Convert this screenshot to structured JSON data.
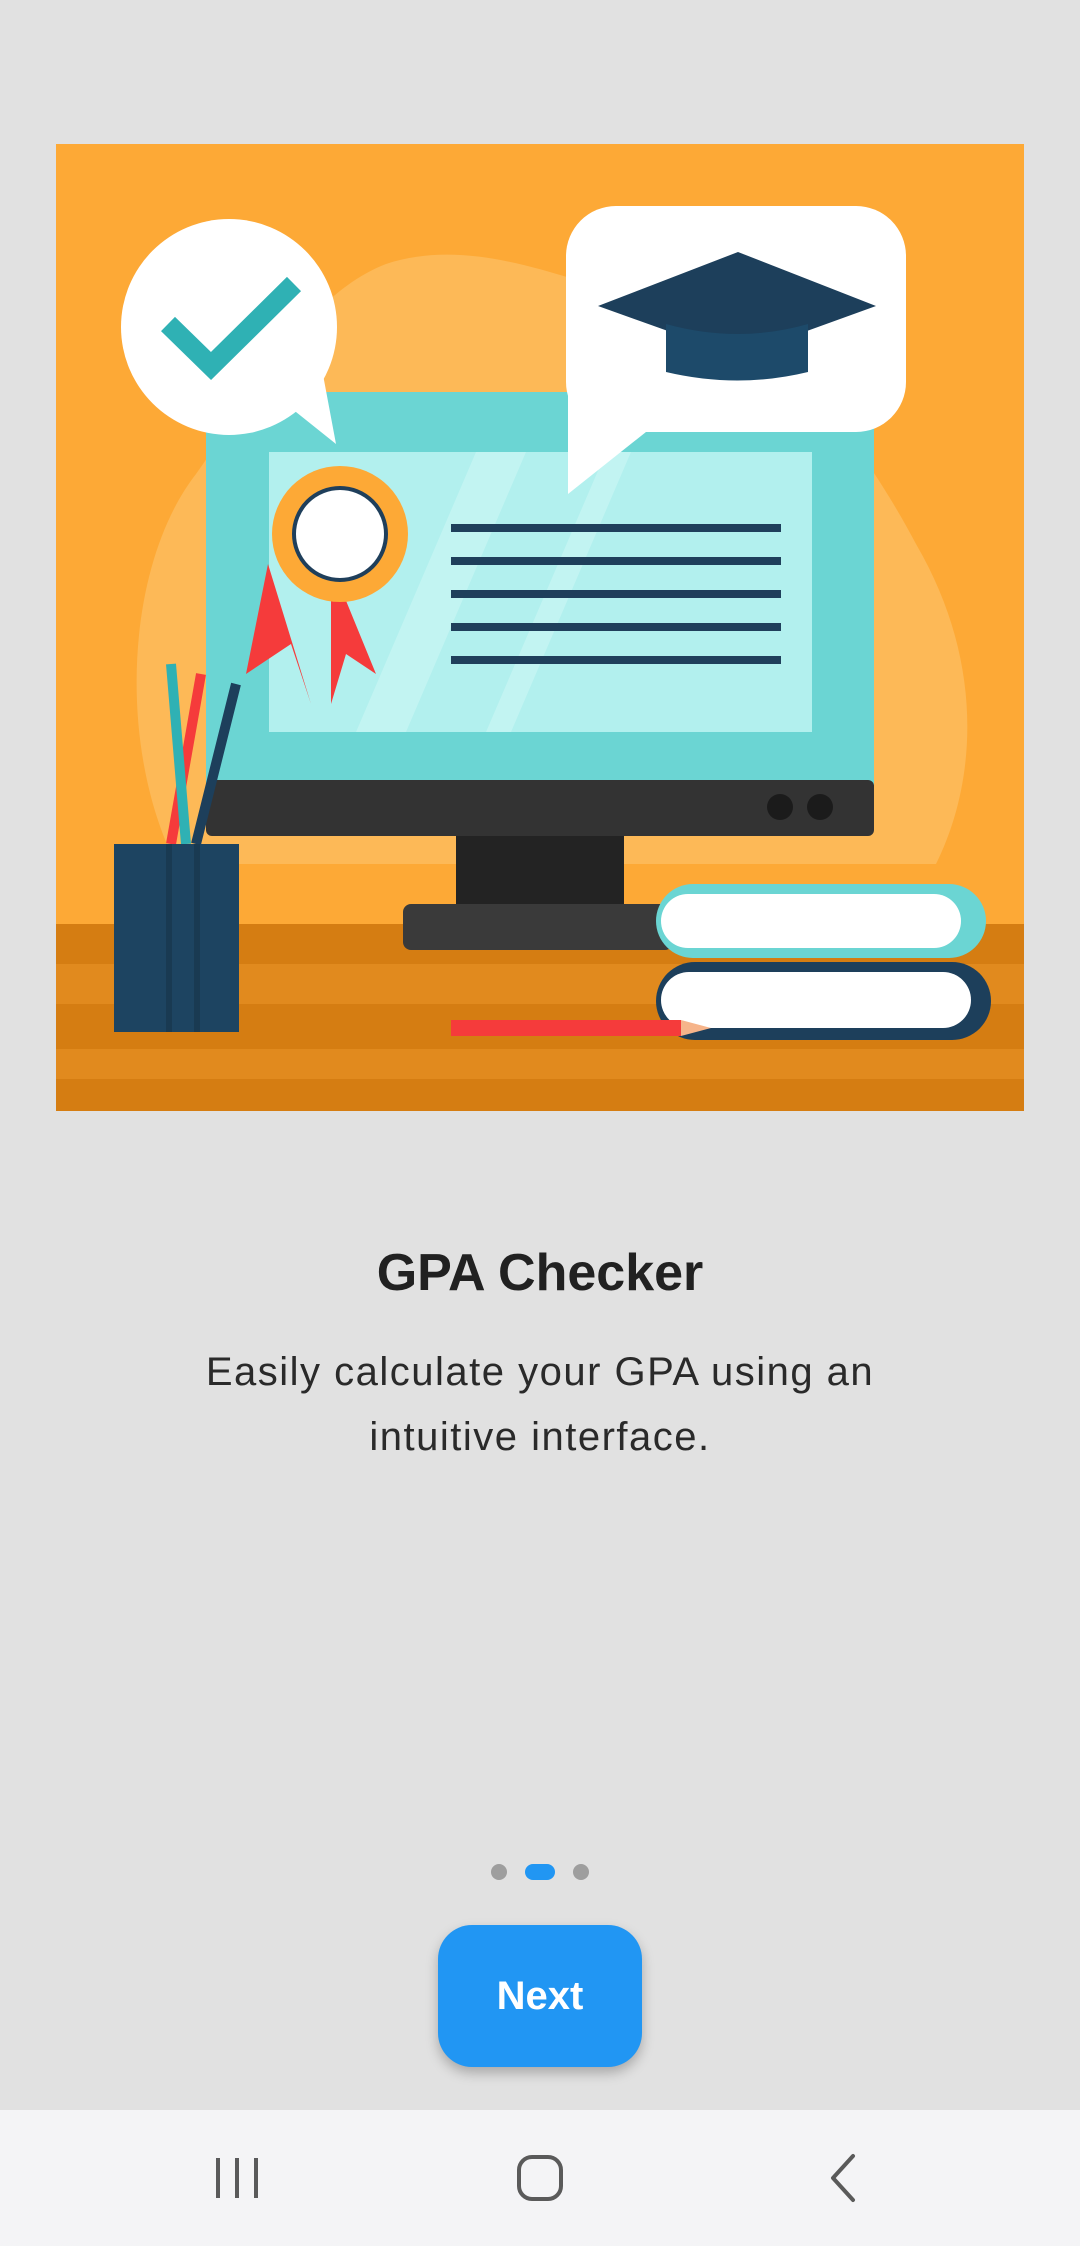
{
  "onboarding": {
    "title": "GPA Checker",
    "description": "Easily calculate your GPA using an intuitive interface.",
    "illustration_icon": "graduation-certificate-monitor-illustration",
    "page_indicator": {
      "total": 3,
      "current": 2
    },
    "next_label": "Next"
  },
  "navbar": {
    "recents_icon": "recents-icon",
    "home_icon": "home-icon",
    "back_icon": "back-icon"
  },
  "colors": {
    "background": "#e1e1e1",
    "accent": "#2196f3",
    "illustration_bg": "#fda936",
    "dot_inactive": "#9e9e9e",
    "navbar_bg": "#f4f4f6"
  }
}
